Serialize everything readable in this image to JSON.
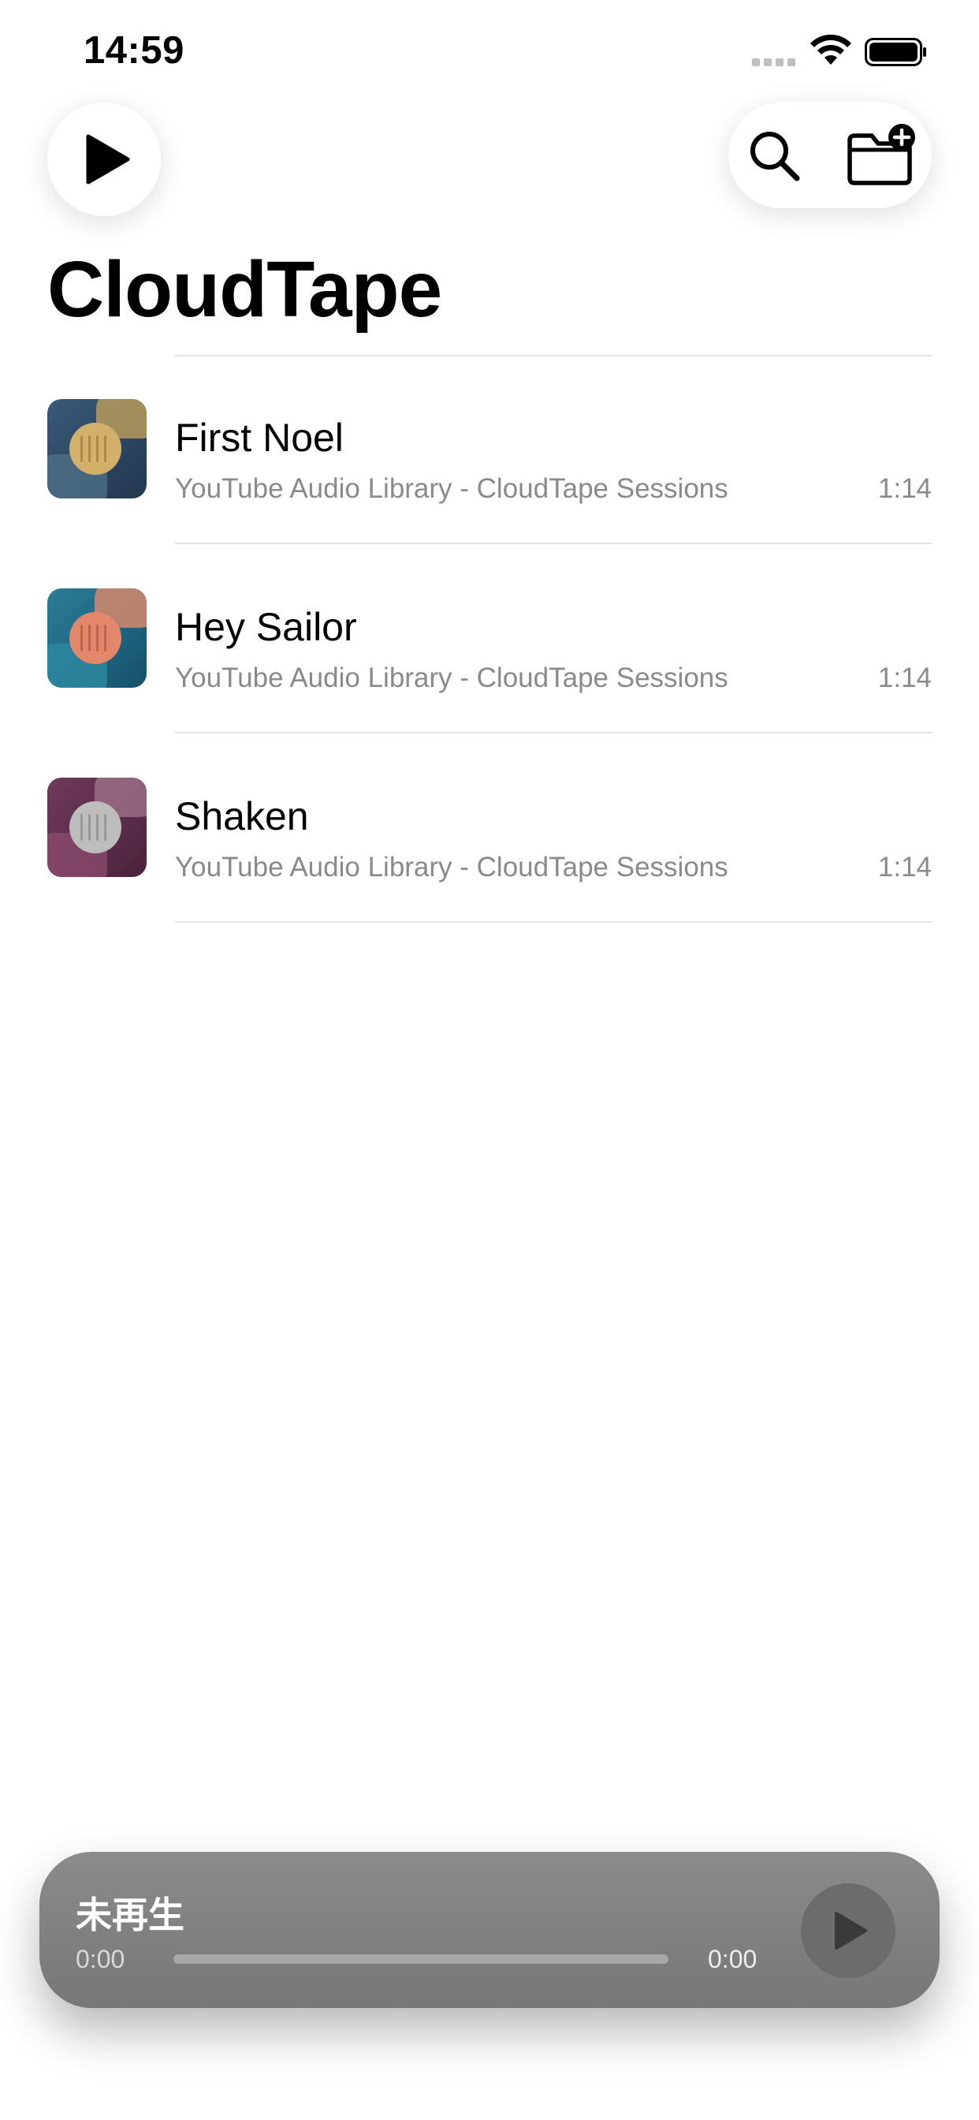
{
  "status_bar": {
    "time": "14:59"
  },
  "toolbar": {
    "play_icon": "play-icon",
    "search_icon": "search-icon",
    "add_folder_icon": "folder-plus-icon"
  },
  "page": {
    "title": "CloudTape"
  },
  "tracks": [
    {
      "title": "First Noel",
      "subtitle": "YouTube Audio Library - CloudTape Sessions",
      "duration": "1:14",
      "art_colors": [
        "#2f4f6e",
        "#c9a45a",
        "#4d6f86"
      ]
    },
    {
      "title": "Hey Sailor",
      "subtitle": "YouTube Audio Library - CloudTape Sessions",
      "duration": "1:14",
      "art_colors": [
        "#1f6c86",
        "#e08a6a",
        "#2d8aa0"
      ]
    },
    {
      "title": "Shaken",
      "subtitle": "YouTube Audio Library - CloudTape Sessions",
      "duration": "1:14",
      "art_colors": [
        "#5e2c4a",
        "#b9b9b9",
        "#8a4a6a"
      ]
    }
  ],
  "now_playing": {
    "label": "未再生",
    "elapsed": "0:00",
    "total": "0:00",
    "progress": 0,
    "play_icon": "play-icon"
  }
}
